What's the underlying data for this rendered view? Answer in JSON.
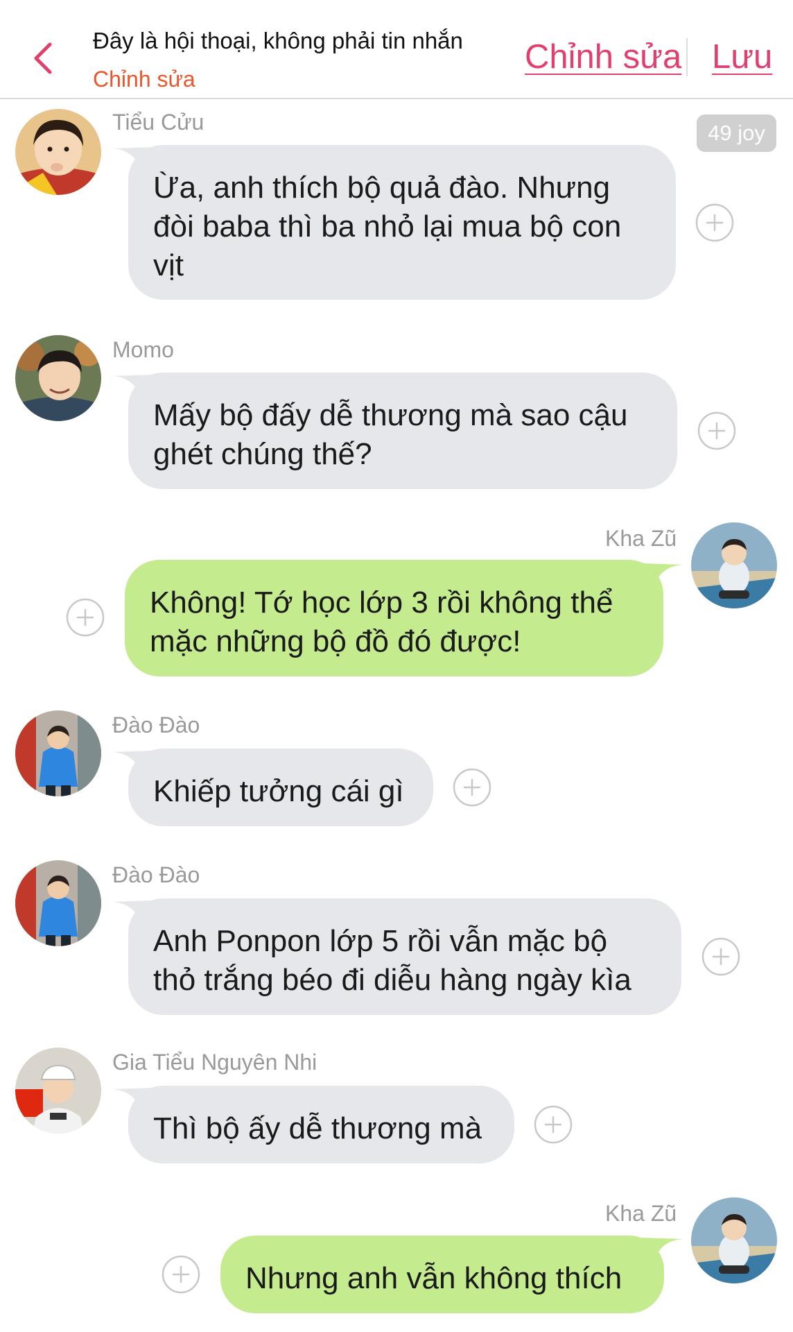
{
  "header": {
    "title": "Đây là hội thoại, không phải tin nhắn",
    "subtitle": "Chỉnh sửa",
    "edit_label": "Chỉnh sửa",
    "save_label": "Lưu",
    "accent_color": "#e0406d"
  },
  "badge": "49 joy",
  "messages": [
    {
      "sender": "Tiểu Cửu",
      "text": "Ừa, anh thích bộ quả đào. Nhưng đòi baba thì ba nhỏ lại mua bộ con vịt",
      "side": "left"
    },
    {
      "sender": "Momo",
      "text": "Mấy bộ đấy dễ thương mà sao cậu ghét chúng thế?",
      "side": "left"
    },
    {
      "sender": "Kha Zũ",
      "text": "Không! Tớ học lớp 3 rồi không thể mặc những bộ đồ đó được!",
      "side": "right"
    },
    {
      "sender": "Đào Đào",
      "text": "Khiếp tưởng cái gì",
      "side": "left"
    },
    {
      "sender": "Đào Đào",
      "text": "Anh Ponpon lớp 5 rồi vẫn mặc bộ thỏ trắng béo đi diễu hàng ngày kìa",
      "side": "left"
    },
    {
      "sender": "Gia Tiểu Nguyên Nhi",
      "text": "Thì bộ ấy dễ thương mà",
      "side": "left"
    },
    {
      "sender": "Kha Zũ",
      "text": "Nhưng anh vẫn không thích",
      "side": "right"
    }
  ]
}
